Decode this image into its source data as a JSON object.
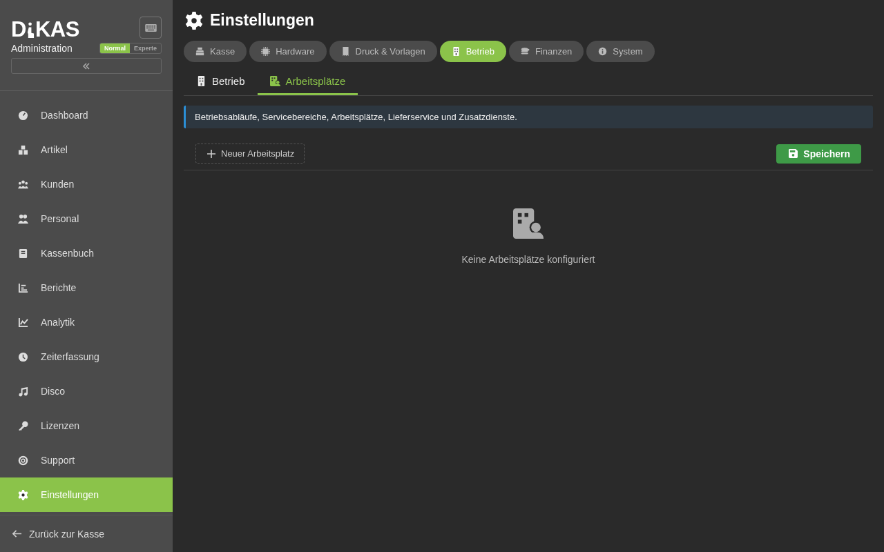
{
  "sidebar": {
    "logo": {
      "left": "D",
      "right": "KAS"
    },
    "subtitle": "Administration",
    "modes": [
      {
        "label": "Normal",
        "selected": true
      },
      {
        "label": "Experte",
        "selected": false
      }
    ],
    "items": [
      {
        "label": "Dashboard",
        "selected": false
      },
      {
        "label": "Artikel",
        "selected": false
      },
      {
        "label": "Kunden",
        "selected": false
      },
      {
        "label": "Personal",
        "selected": false
      },
      {
        "label": "Kassenbuch",
        "selected": false
      },
      {
        "label": "Berichte",
        "selected": false
      },
      {
        "label": "Analytik",
        "selected": false
      },
      {
        "label": "Zeiterfassung",
        "selected": false
      },
      {
        "label": "Disco",
        "selected": false
      },
      {
        "label": "Lizenzen",
        "selected": false
      },
      {
        "label": "Support",
        "selected": false
      },
      {
        "label": "Einstellungen",
        "selected": true
      }
    ],
    "footer": "Zurück zur Kasse"
  },
  "page": {
    "title": "Einstellungen",
    "tabs": [
      {
        "label": "Kasse",
        "selected": false
      },
      {
        "label": "Hardware",
        "selected": false
      },
      {
        "label": "Druck & Vorlagen",
        "selected": false
      },
      {
        "label": "Betrieb",
        "selected": true
      },
      {
        "label": "Finanzen",
        "selected": false
      },
      {
        "label": "System",
        "selected": false
      }
    ],
    "subtabs": [
      {
        "label": "Betrieb",
        "selected": false
      },
      {
        "label": "Arbeitsplätze",
        "selected": true
      }
    ],
    "info": "Betriebsabläufe, Servicebereiche, Arbeitsplätze, Lieferservice und Zusatzdienste.",
    "add_button": "Neuer Arbeitsplatz",
    "save_button": "Speichern",
    "empty_text": "Keine Arbeitsplätze konfiguriert"
  }
}
